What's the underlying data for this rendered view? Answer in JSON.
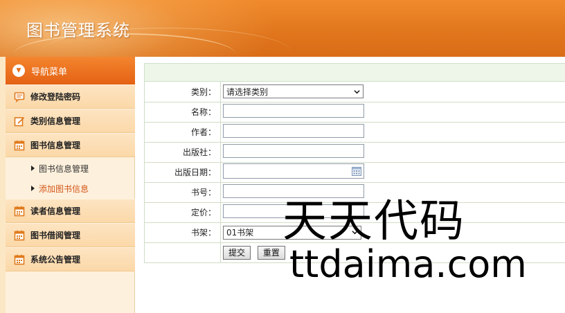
{
  "header": {
    "title": "图书管理系统"
  },
  "sidebar": {
    "nav_title": "导航菜单",
    "nav_icon": "chevron-down-circle-icon",
    "items": [
      {
        "label": "修改登陆密码",
        "icon": "message-icon"
      },
      {
        "label": "类别信息管理",
        "icon": "edit-icon"
      },
      {
        "label": "图书信息管理",
        "icon": "calendar-icon",
        "sub": [
          {
            "label": "图书信息管理",
            "active": false
          },
          {
            "label": "添加图书信息",
            "active": true
          }
        ]
      },
      {
        "label": "读者信息管理",
        "icon": "calendar-icon"
      },
      {
        "label": "图书借阅管理",
        "icon": "calendar-icon"
      },
      {
        "label": "系统公告管理",
        "icon": "calendar-icon"
      }
    ]
  },
  "form": {
    "category_label": "类别：",
    "category_value": "请选择类别",
    "name_label": "名称：",
    "author_label": "作者：",
    "publisher_label": "出版社：",
    "pubdate_label": "出版日期：",
    "booknum_label": "书号：",
    "price_label": "定价：",
    "shelf_label": "书架：",
    "shelf_value": "01书架",
    "submit_label": "提交",
    "reset_label": "重置"
  },
  "watermark": {
    "line1": "天天代码",
    "line2": "ttdaima.com"
  },
  "colors": {
    "header": "#e47a1f",
    "nav_head": "#e86a17",
    "sidebar_bg": "#fdf0dc",
    "active_sub": "#d4561a",
    "form_bar": "#eef6ea"
  }
}
